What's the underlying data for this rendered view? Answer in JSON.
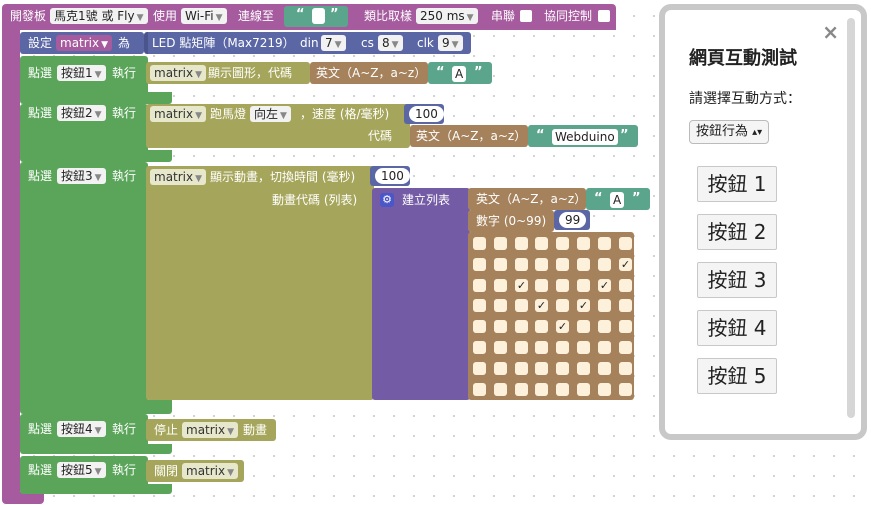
{
  "board": {
    "label": "開發板",
    "board_type": "馬克1號 或 Fly",
    "use_label": "使用",
    "conn_type": "Wi-Fi",
    "connect_label": "連線至",
    "quote_open": "“",
    "quote_close": "”",
    "sampling_label": "類比取樣",
    "sampling_value": "250 ms",
    "serial_label": "串聯",
    "co_label": "協同控制"
  },
  "setup": {
    "set_label": "設定",
    "var_name": "matrix",
    "as_label": "為",
    "led_label": "LED 點矩陣（Max7219）",
    "din_label": "din",
    "din_value": "7",
    "cs_label": "cs",
    "cs_value": "8",
    "clk_label": "clk",
    "clk_value": "9"
  },
  "handlers": [
    {
      "click_label": "點選",
      "button": "按鈕1",
      "exec_label": "執行"
    },
    {
      "click_label": "點選",
      "button": "按鈕2",
      "exec_label": "執行"
    },
    {
      "click_label": "點選",
      "button": "按鈕3",
      "exec_label": "執行"
    },
    {
      "click_label": "點選",
      "button": "按鈕4",
      "exec_label": "執行"
    },
    {
      "click_label": "點選",
      "button": "按鈕5",
      "exec_label": "執行"
    }
  ],
  "b1": {
    "var": "matrix",
    "action": "顯示圖形，代碼",
    "letter_label": "英文（A~Z，a~z）",
    "letter_value": "A"
  },
  "b2": {
    "var": "matrix",
    "action": "跑馬燈",
    "direction": "向左",
    "speed_label": "，速度 (格/毫秒)",
    "speed_value": "100",
    "code_label": "代碼",
    "letter_label": "英文（A~Z，a~z）",
    "text_value": "Webduino"
  },
  "b3": {
    "var": "matrix",
    "action": "顯示動畫，切換時間 (毫秒)",
    "time_value": "100",
    "code_label": "動畫代碼 (列表)",
    "list_label": "建立列表",
    "letter_label": "英文（A~Z，a~z）",
    "letter_value": "A",
    "number_label": "數字 (0~99)",
    "number_value": "99",
    "checked_cells": [
      [
        1,
        7
      ],
      [
        2,
        2
      ],
      [
        2,
        6
      ],
      [
        3,
        3
      ],
      [
        3,
        5
      ],
      [
        4,
        4
      ]
    ],
    "check_mark": "✓"
  },
  "b4": {
    "stop_label": "停止",
    "var": "matrix",
    "anim_label": "動畫"
  },
  "b5": {
    "close_label": "關閉",
    "var": "matrix"
  },
  "panel": {
    "title": "網頁互動測試",
    "prompt": "請選擇互動方式：",
    "select_value": "按鈕行為",
    "select_arrow": "▴▾",
    "close_icon": "×",
    "buttons": [
      "按鈕 1",
      "按鈕 2",
      "按鈕 3",
      "按鈕 4",
      "按鈕 5"
    ]
  },
  "colors": {
    "board": "#a55b9e",
    "setup": "#5b67a5",
    "event": "#5ba55b",
    "matrix": "#a5a55b",
    "list": "#745ba5",
    "text": "#a5825b",
    "string": "#5ba58c"
  }
}
